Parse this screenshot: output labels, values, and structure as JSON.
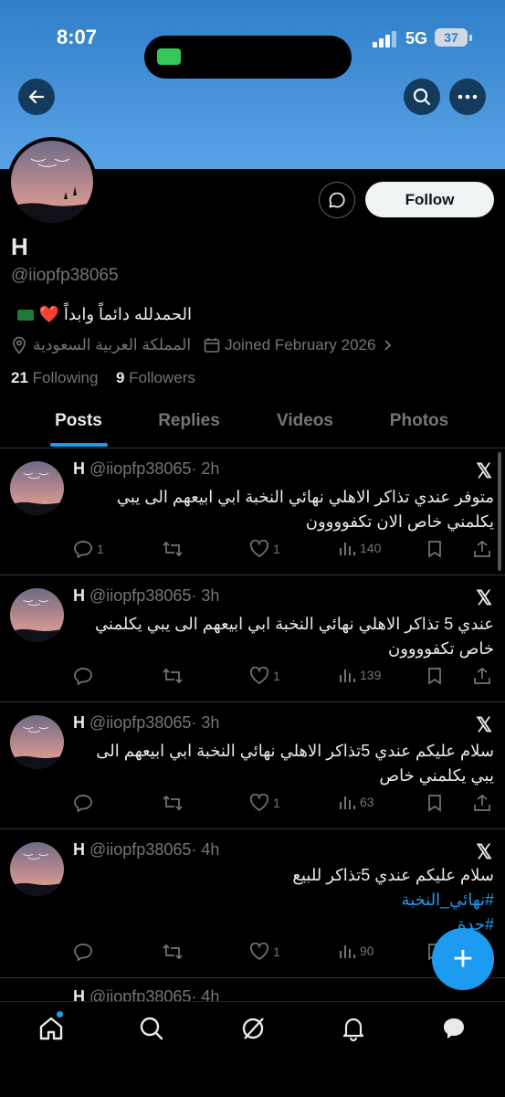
{
  "status_bar": {
    "time": "8:07",
    "network": "5G",
    "battery": "37"
  },
  "header": {
    "back_icon": "arrow-left-icon",
    "search_icon": "search-icon",
    "more_icon": "more-icon"
  },
  "profile": {
    "name": "H",
    "handle": "@iiopfp38065",
    "bio": "الحمدلله دائماً وابداً",
    "location": "المملكة العربية السعودية",
    "joined": "Joined February 2026",
    "following_count": "21",
    "following_label": "Following",
    "followers_count": "9",
    "followers_label": "Followers",
    "follow_label": "Follow"
  },
  "tabs": [
    {
      "label": "Posts",
      "active": true
    },
    {
      "label": "Replies",
      "active": false
    },
    {
      "label": "Videos",
      "active": false
    },
    {
      "label": "Photos",
      "active": false
    }
  ],
  "posts": [
    {
      "name": "H",
      "handle": "@iiopfp38065",
      "time": "· 2h",
      "lines": [
        "متوفر عندي تذاكر الاهلي نهائي النخبة ابي ابيعهم الى يبي",
        "يكلمني خاص الان تكفوووون"
      ],
      "replies": "1",
      "retweets": "",
      "likes": "1",
      "views": "140"
    },
    {
      "name": "H",
      "handle": "@iiopfp38065",
      "time": "· 3h",
      "lines": [
        "عندي 5 تذاكر الاهلي نهائي النخبة ابي ابيعهم الى يبي يكلمني",
        "خاص تكفوووون"
      ],
      "replies": "",
      "retweets": "",
      "likes": "1",
      "views": "139"
    },
    {
      "name": "H",
      "handle": "@iiopfp38065",
      "time": "· 3h",
      "lines": [
        "سلام عليكم عندي 5تذاكر الاهلي نهائي النخبة ابي ابيعهم الى",
        "يبي يكلمني خاص"
      ],
      "replies": "",
      "retweets": "",
      "likes": "1",
      "views": "63"
    },
    {
      "name": "H",
      "handle": "@iiopfp38065",
      "time": "· 4h",
      "lines": [
        "سلام عليكم عندي 5تذاكر للبيع"
      ],
      "tags": [
        "#نهائي_النخبة",
        "#جدة"
      ],
      "replies": "",
      "retweets": "",
      "likes": "1",
      "views": "90"
    }
  ],
  "partial_post": {
    "name": "H",
    "handle": "@iiopfp38065",
    "time": "· 4h"
  },
  "compose_label": "+",
  "colors": {
    "accent": "#1d9bf0",
    "banner": "#4a93d8",
    "background": "#000000"
  }
}
